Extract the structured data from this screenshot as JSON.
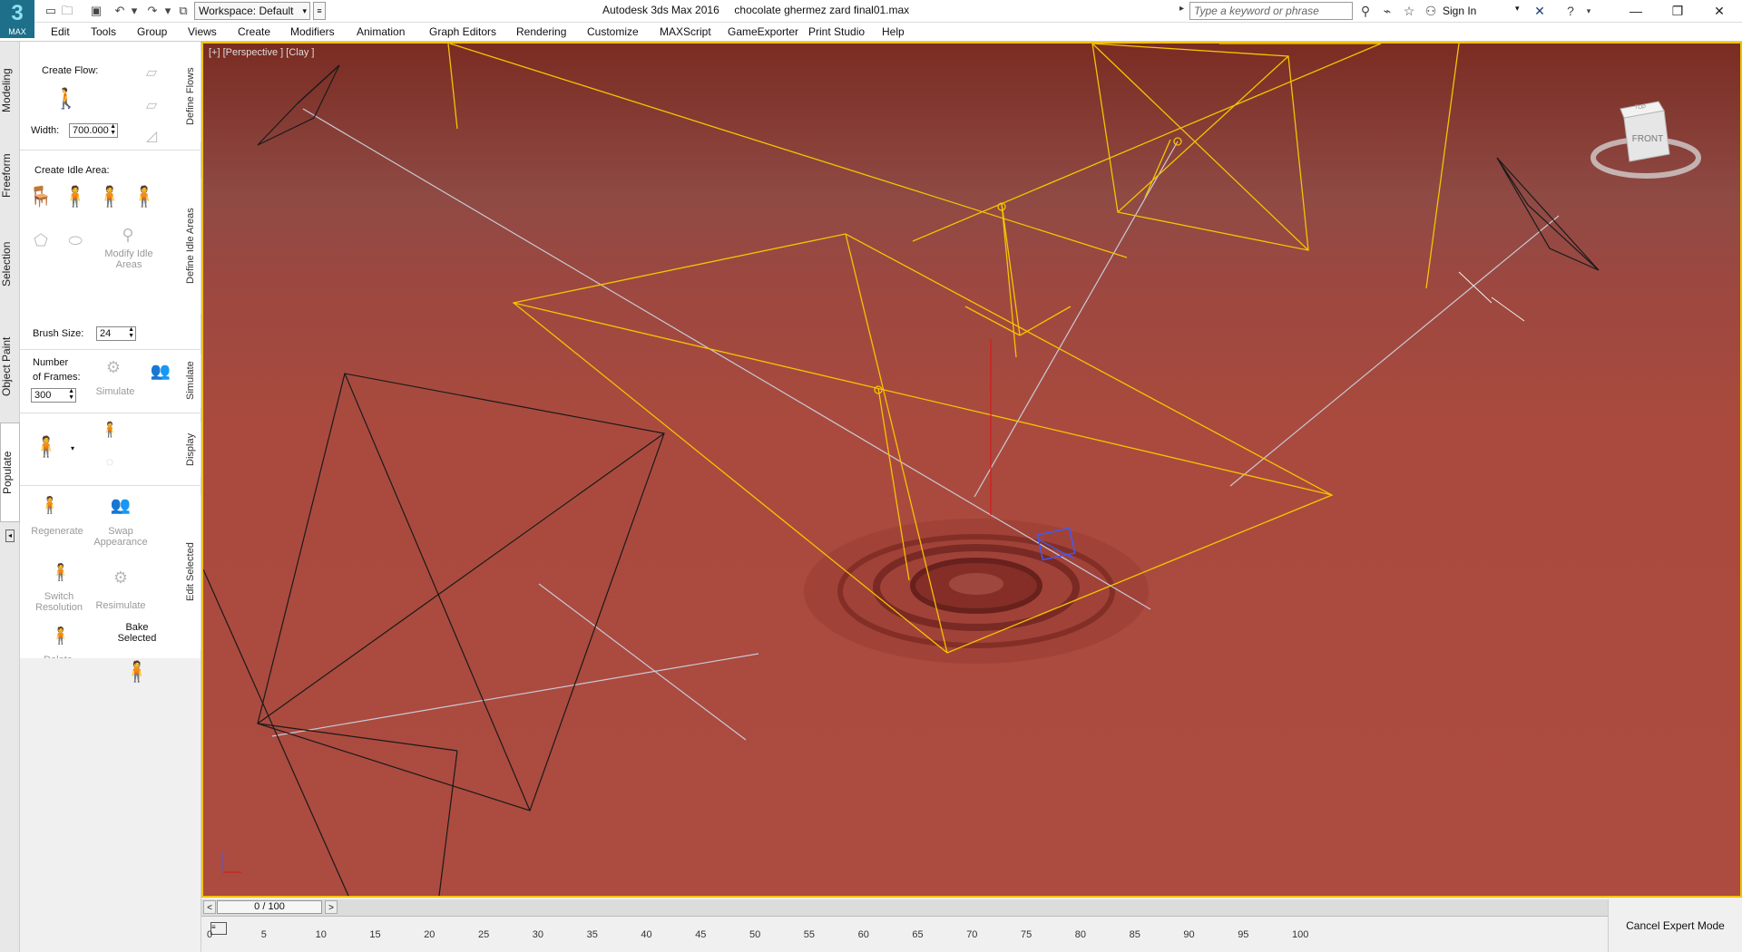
{
  "app": {
    "logo_text": "MAX",
    "title": "Autodesk 3ds Max 2016     chocolate ghermez zard final01.max",
    "workspace_label": "Workspace: Default"
  },
  "search": {
    "placeholder": "Type a keyword or phrase"
  },
  "account": {
    "sign_in": "Sign In"
  },
  "menu": [
    "Edit",
    "Tools",
    "Group",
    "Views",
    "Create",
    "Modifiers",
    "Animation",
    "Graph Editors",
    "Rendering",
    "Customize",
    "MAXScript",
    "GameExporter",
    "Print Studio",
    "Help"
  ],
  "command_tabs": [
    "Modeling",
    "Freeform",
    "Selection",
    "Object Paint",
    "Populate"
  ],
  "active_tab": "Populate",
  "populate": {
    "define_flows": {
      "side_label": "Define Flows",
      "create_flow": "Create Flow:",
      "width_label": "Width:",
      "width_value": "700.000"
    },
    "define_idle": {
      "side_label": "Define Idle Areas",
      "create_idle": "Create Idle Area:",
      "modify_idle": "Modify Idle Areas",
      "brush_label": "Brush Size:",
      "brush_value": "24"
    },
    "simulate": {
      "side_label": "Simulate",
      "frames_label_1": "Number",
      "frames_label_2": "of Frames:",
      "frames_value": "300",
      "simulate_btn": "Simulate"
    },
    "display": {
      "side_label": "Display"
    },
    "edit_selected": {
      "side_label": "Edit Selected",
      "regenerate": "Regenerate",
      "swap": "Swap Appearance",
      "switch_res": "Switch Resolution",
      "resimulate": "Resimulate",
      "delete": "Delete",
      "bake": "Bake Selected"
    }
  },
  "viewport": {
    "label": "[+] [Perspective ] [Clay ]",
    "viewcube_face": "FRONT",
    "viewcube_top": "TOP"
  },
  "timeline": {
    "position": "0 / 100",
    "ticks": [
      "0",
      "5",
      "10",
      "15",
      "20",
      "25",
      "30",
      "35",
      "40",
      "45",
      "50",
      "55",
      "60",
      "65",
      "70",
      "75",
      "80",
      "85",
      "90",
      "95",
      "100"
    ]
  },
  "status": {
    "cancel_expert": "Cancel Expert Mode"
  },
  "colors": {
    "viewport_border": "#f2c200",
    "viewport_bg": "#ac4b3f",
    "selected_lines": "#f5c400",
    "wire_black": "#1a1a1a",
    "wire_light": "#c9c9d6"
  }
}
